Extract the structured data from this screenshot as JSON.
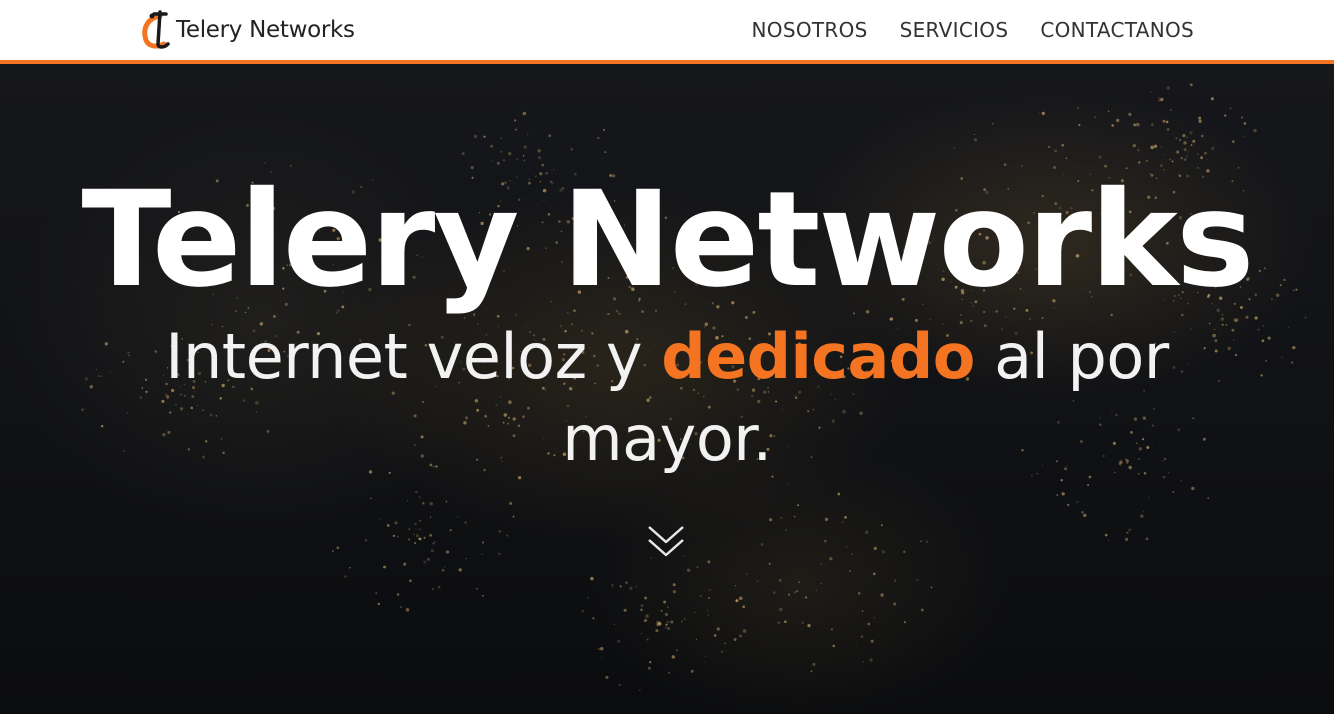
{
  "brand": {
    "name": "Telery Networks",
    "accent_color": "#f47421"
  },
  "nav": {
    "items": [
      {
        "label": "NOSOTROS"
      },
      {
        "label": "SERVICIOS"
      },
      {
        "label": "CONTACTANOS"
      }
    ]
  },
  "hero": {
    "title": "Telery Networks",
    "subtitle_before": "Internet veloz y ",
    "subtitle_accent": "dedicado",
    "subtitle_after": " al por mayor.",
    "scroll_icon": "double-chevron-down-icon"
  }
}
